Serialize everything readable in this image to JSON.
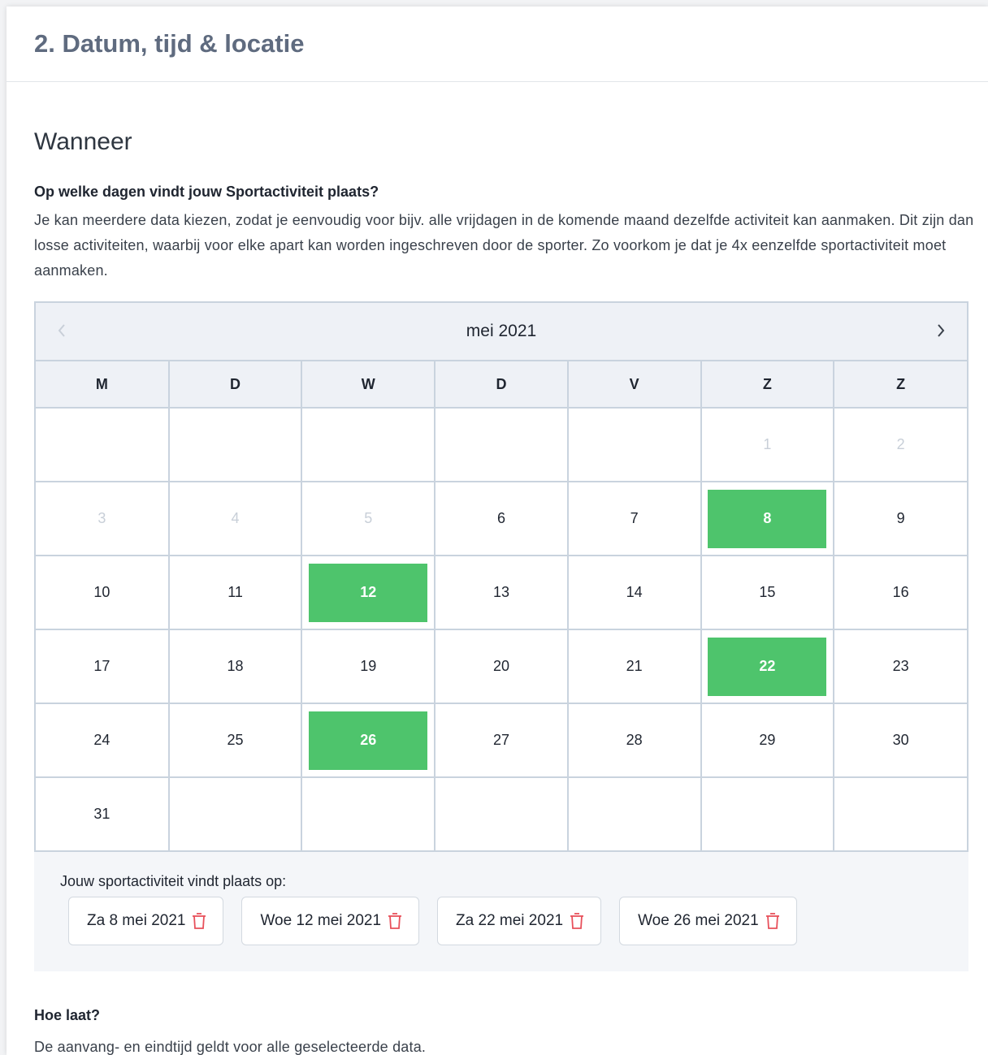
{
  "header": {
    "title": "2. Datum, tijd & locatie"
  },
  "when": {
    "title": "Wanneer",
    "question": "Op welke dagen vindt jouw Sportactiviteit plaats?",
    "description": "Je kan meerdere data kiezen, zodat je eenvoudig voor bijv. alle vrijdagen in de komende maand dezelfde activiteit kan aanmaken. Dit zijn dan losse activiteiten, waarbij voor elke apart kan worden ingeschreven door de sporter. Zo voorkom je dat je 4x eenzelfde sportactiviteit moet aanmaken."
  },
  "calendar": {
    "month_label": "mei 2021",
    "prev_icon": "chevron-left-icon",
    "next_icon": "chevron-right-icon",
    "weekdays": [
      "M",
      "D",
      "W",
      "D",
      "V",
      "Z",
      "Z"
    ],
    "weeks": [
      [
        {
          "d": ""
        },
        {
          "d": ""
        },
        {
          "d": ""
        },
        {
          "d": ""
        },
        {
          "d": ""
        },
        {
          "d": "1",
          "muted": true
        },
        {
          "d": "2",
          "muted": true
        }
      ],
      [
        {
          "d": "3",
          "muted": true
        },
        {
          "d": "4",
          "muted": true
        },
        {
          "d": "5",
          "muted": true
        },
        {
          "d": "6"
        },
        {
          "d": "7"
        },
        {
          "d": "8",
          "selected": true
        },
        {
          "d": "9"
        }
      ],
      [
        {
          "d": "10"
        },
        {
          "d": "11"
        },
        {
          "d": "12",
          "selected": true
        },
        {
          "d": "13"
        },
        {
          "d": "14"
        },
        {
          "d": "15"
        },
        {
          "d": "16"
        }
      ],
      [
        {
          "d": "17"
        },
        {
          "d": "18"
        },
        {
          "d": "19"
        },
        {
          "d": "20"
        },
        {
          "d": "21"
        },
        {
          "d": "22",
          "selected": true
        },
        {
          "d": "23"
        }
      ],
      [
        {
          "d": "24"
        },
        {
          "d": "25"
        },
        {
          "d": "26",
          "selected": true
        },
        {
          "d": "27"
        },
        {
          "d": "28"
        },
        {
          "d": "29"
        },
        {
          "d": "30"
        }
      ],
      [
        {
          "d": "31"
        },
        {
          "d": ""
        },
        {
          "d": ""
        },
        {
          "d": ""
        },
        {
          "d": ""
        },
        {
          "d": ""
        },
        {
          "d": ""
        }
      ]
    ],
    "selected_color": "#4ec46c"
  },
  "summary": {
    "label": "Jouw sportactiviteit vindt plaats op:",
    "chips": [
      "Za 8 mei 2021",
      "Woe 12 mei 2021",
      "Za 22 mei 2021",
      "Woe 26 mei 2021"
    ],
    "chip_icon": "trash-icon",
    "chip_icon_color": "#e8505b"
  },
  "time": {
    "question": "Hoe laat?",
    "description": "De aanvang- en eindtijd geldt voor alle geselecteerde data."
  }
}
